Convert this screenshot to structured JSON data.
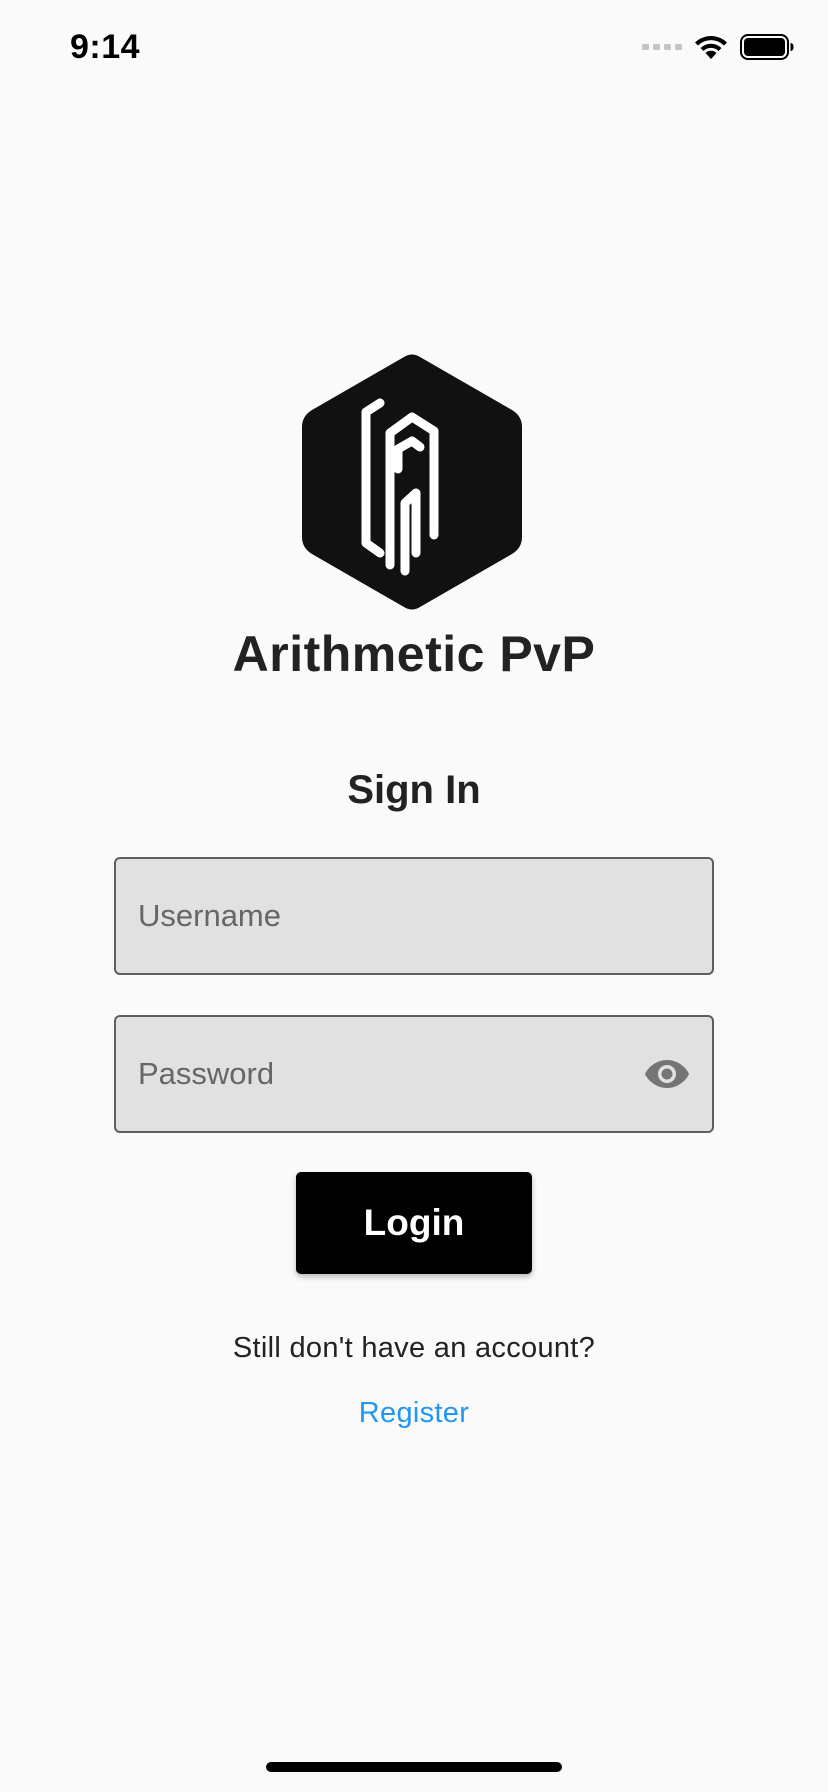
{
  "status_bar": {
    "time": "9:14",
    "icons": [
      "signal-icon",
      "wifi-icon",
      "battery-icon"
    ]
  },
  "app": {
    "logo_icon": "app-logo-hexagon",
    "title": "Arithmetic PvP"
  },
  "form": {
    "heading": "Sign In",
    "username": {
      "value": "",
      "placeholder": "Username"
    },
    "password": {
      "value": "",
      "placeholder": "Password",
      "toggle_icon": "eye-icon"
    },
    "login_label": "Login"
  },
  "footer": {
    "prompt": "Still don't have an account?",
    "register_label": "Register"
  },
  "colors": {
    "background": "#fafafa",
    "field_fill": "#e1e1e1",
    "button_fill": "#000000",
    "link": "#2196f3"
  }
}
